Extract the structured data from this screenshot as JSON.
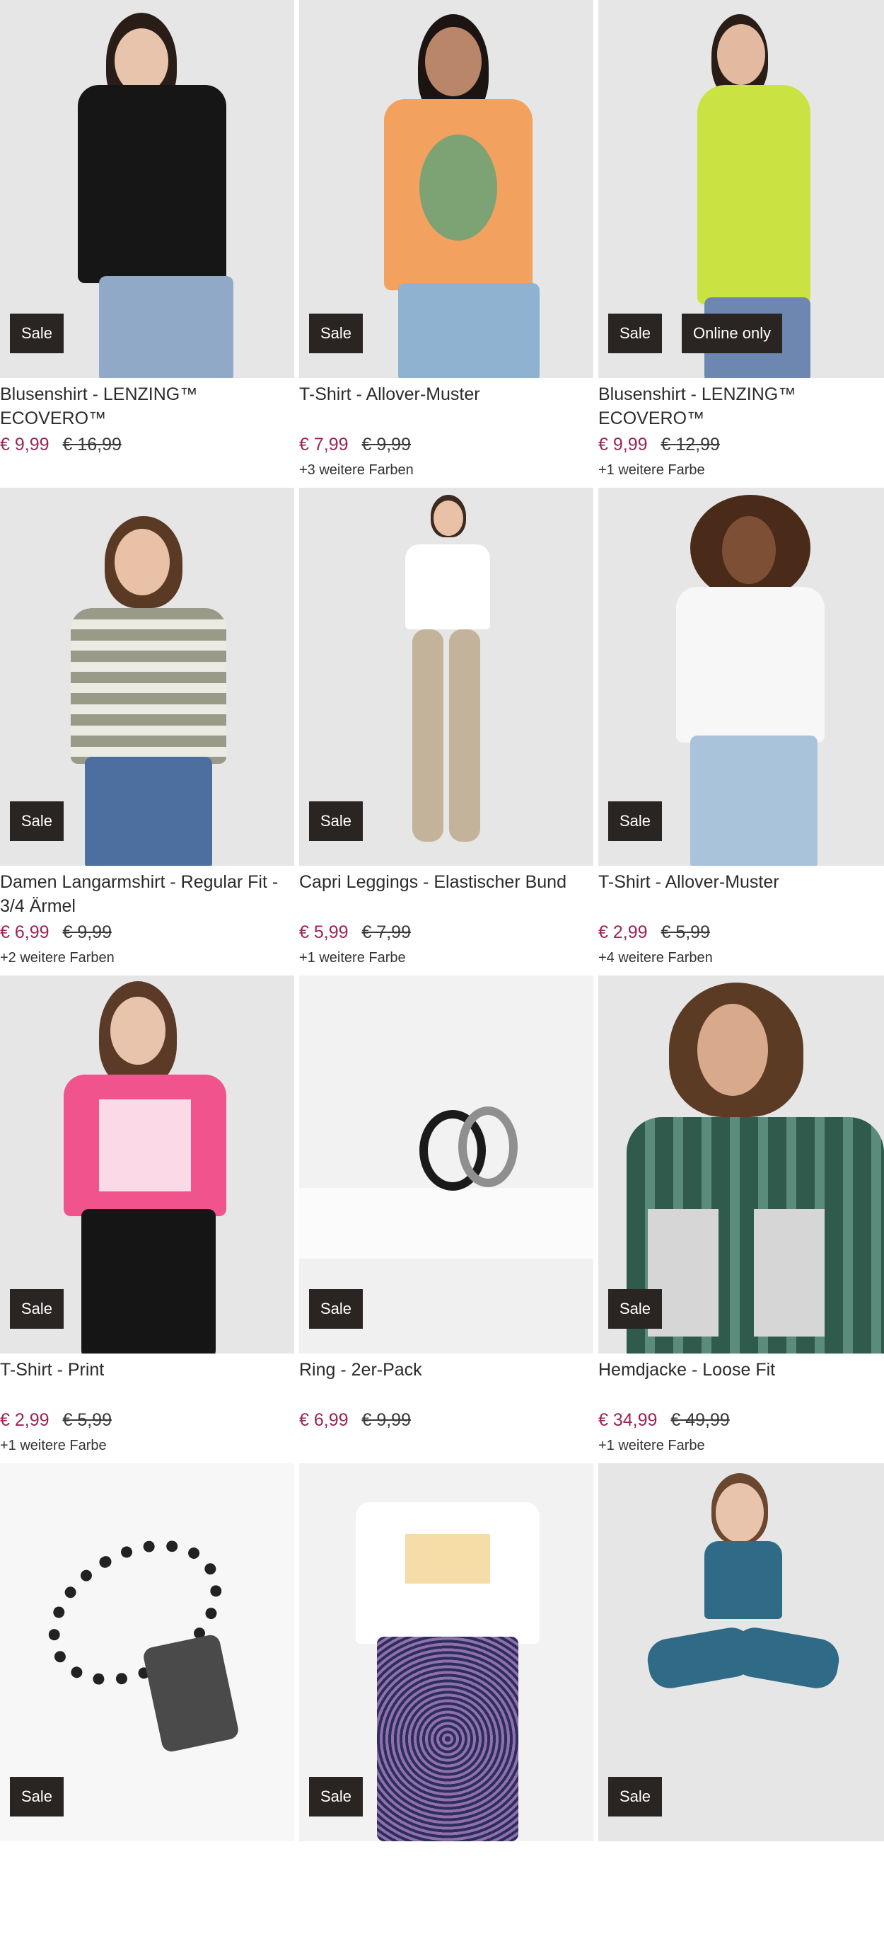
{
  "products": [
    {
      "name": "Blusenshirt - LENZING™ ECOVERO™",
      "price": "€ 9,99",
      "old_price": "€ 16,99",
      "colors": "",
      "badges": [
        "Sale"
      ]
    },
    {
      "name": "T-Shirt - Allover-Muster",
      "price": "€ 7,99",
      "old_price": "€ 9,99",
      "colors": "+3 weitere Farben",
      "badges": [
        "Sale"
      ]
    },
    {
      "name": "Blusenshirt - LENZING™ ECOVERO™",
      "price": "€ 9,99",
      "old_price": "€ 12,99",
      "colors": "+1 weitere Farbe",
      "badges": [
        "Sale",
        "Online only"
      ]
    },
    {
      "name": "Damen Langarmshirt - Regular Fit - 3/4 Ärmel",
      "price": "€ 6,99",
      "old_price": "€ 9,99",
      "colors": "+2 weitere Farben",
      "badges": [
        "Sale"
      ]
    },
    {
      "name": "Capri Leggings - Elastischer Bund",
      "price": "€ 5,99",
      "old_price": "€ 7,99",
      "colors": "+1 weitere Farbe",
      "badges": [
        "Sale"
      ]
    },
    {
      "name": "T-Shirt - Allover-Muster",
      "price": "€ 2,99",
      "old_price": "€ 5,99",
      "colors": "+4 weitere Farben",
      "badges": [
        "Sale"
      ]
    },
    {
      "name": "T-Shirt - Print",
      "price": "€ 2,99",
      "old_price": "€ 5,99",
      "colors": "+1 weitere Farbe",
      "badges": [
        "Sale"
      ]
    },
    {
      "name": "Ring - 2er-Pack",
      "price": "€ 6,99",
      "old_price": "€ 9,99",
      "colors": "",
      "badges": [
        "Sale"
      ]
    },
    {
      "name": "Hemdjacke - Loose Fit",
      "price": "€ 34,99",
      "old_price": "€ 49,99",
      "colors": "+1 weitere Farbe",
      "badges": [
        "Sale"
      ]
    },
    {
      "name": "",
      "price": "",
      "old_price": "",
      "colors": "",
      "badges": [
        "Sale"
      ]
    },
    {
      "name": "",
      "price": "",
      "old_price": "",
      "colors": "",
      "badges": [
        "Sale"
      ]
    },
    {
      "name": "",
      "price": "",
      "old_price": "",
      "colors": "",
      "badges": [
        "Sale"
      ]
    }
  ],
  "colors": {
    "sale_price": "#9b2456",
    "badge_bg": "#2a2422",
    "text": "#2b2b2b"
  }
}
